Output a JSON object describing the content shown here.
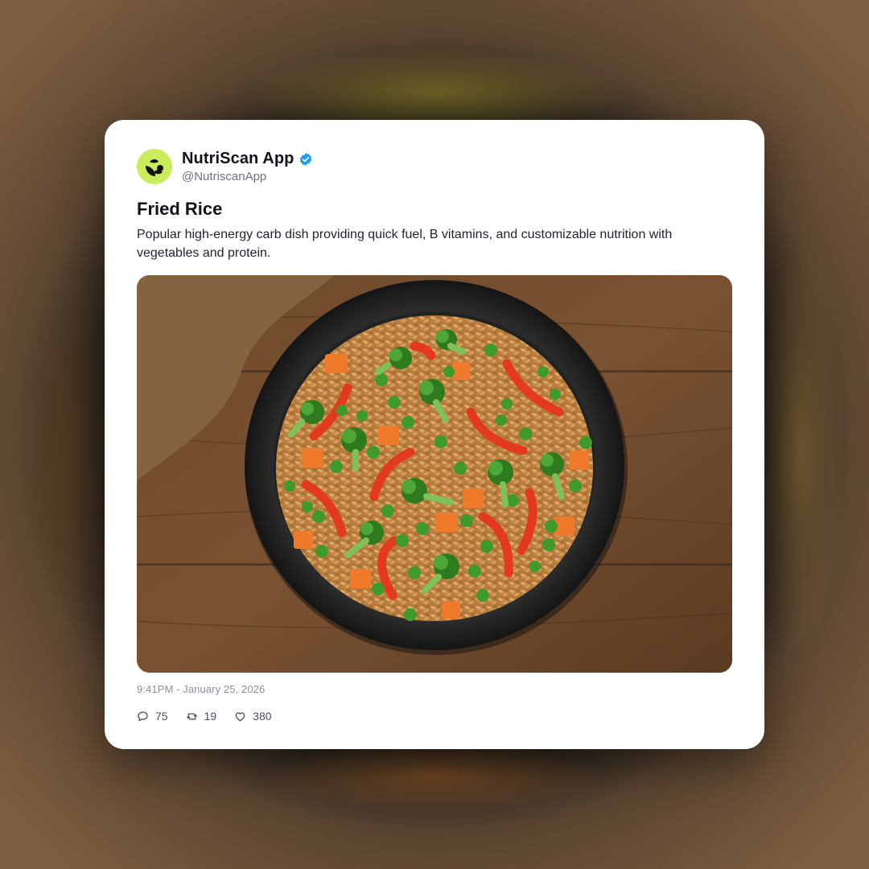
{
  "post": {
    "author": {
      "display_name": "NutriScan App",
      "handle": "@NutriscanApp",
      "verified": true,
      "avatar_color": "#c9ec5a"
    },
    "title": "Fried Rice",
    "body": "Popular high-energy carb dish providing quick fuel, B vitamins, and customizable nutrition with vegetables and protein.",
    "image_icon": "fried-rice-photo",
    "timestamp": "9:41PM - January 25, 2026",
    "stats": {
      "replies": "75",
      "reposts": "19",
      "likes": "380"
    }
  },
  "colors": {
    "verified_badge": "#1d9bf0",
    "card_background": "#ffffff",
    "text_primary": "#0f1419",
    "text_secondary": "#6b7280"
  },
  "icons": {
    "reply": "comment-icon",
    "repost": "repost-icon",
    "like": "heart-icon",
    "verified": "verified-badge-icon",
    "avatar": "nutriscan-logo-icon"
  }
}
